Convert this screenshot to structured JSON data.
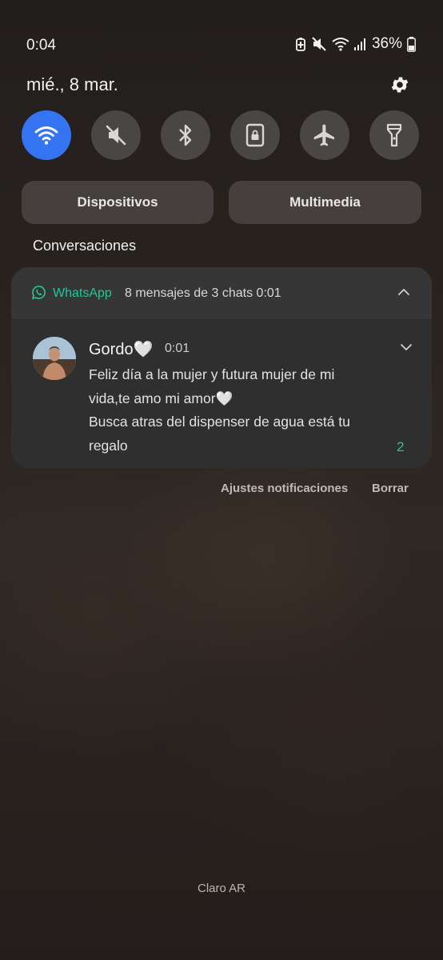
{
  "status_bar": {
    "time": "0:04",
    "battery_percent": "36%",
    "icons": [
      "battery-saver-icon",
      "mute-icon",
      "wifi-icon",
      "signal-icon",
      "battery-icon"
    ]
  },
  "panel": {
    "date": "mié., 8 mar.",
    "toggles": [
      {
        "icon": "wifi-icon",
        "on": true
      },
      {
        "icon": "sound-mute-icon",
        "on": false
      },
      {
        "icon": "bluetooth-icon",
        "on": false
      },
      {
        "icon": "portrait-lock-icon",
        "on": false
      },
      {
        "icon": "airplane-icon",
        "on": false
      },
      {
        "icon": "flashlight-icon",
        "on": false
      }
    ],
    "devices_label": "Dispositivos",
    "media_label": "Multimedia"
  },
  "conversations": {
    "section_title": "Conversaciones",
    "notification": {
      "app_name": "WhatsApp",
      "summary": "8 mensajes de 3 chats  0:01",
      "sender": "Gordo🤍",
      "time": "0:01",
      "message_lines": [
        "Feliz día a la mujer y futura mujer de mi",
        "vida,te amo mi amor🤍",
        "Busca atras del dispenser de agua está tu",
        "regalo"
      ],
      "count": "2"
    }
  },
  "actions": {
    "notification_settings": "Ajustes notificaciones",
    "clear": "Borrar"
  },
  "carrier": "Claro AR",
  "colors": {
    "accent_toggle": "#3474f3",
    "whatsapp_green": "#23c69a"
  }
}
